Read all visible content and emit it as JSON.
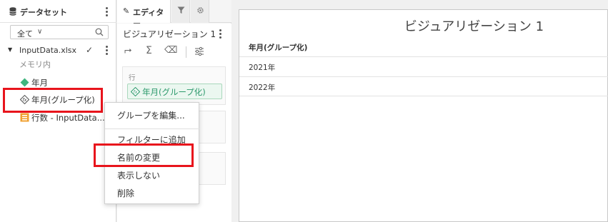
{
  "dataset_panel": {
    "title": "データセット",
    "filter_value": "全て",
    "file": {
      "name": "InputData.xlsx",
      "location": "メモリ内"
    },
    "fields": [
      {
        "label": "年月",
        "icon": "diamond-field-icon"
      },
      {
        "label": "年月(グループ化)",
        "icon": "calculated-field-icon"
      },
      {
        "label": "行数 - InputData...",
        "icon": "row-count-icon"
      }
    ]
  },
  "editor_panel": {
    "tab_label": "エディター",
    "visualization_name": "ビジュアリゼーション 1",
    "row_caption": "行",
    "row_field": "年月(グループ化)"
  },
  "context_menu": {
    "items": [
      "グループを編集...",
      "フィルターに追加",
      "名前の変更",
      "表示しない",
      "削除"
    ]
  },
  "visualization": {
    "title": "ビジュアリゼーション 1",
    "column_header": "年月(グループ化)",
    "rows": [
      "2021年",
      "2022年"
    ]
  },
  "colors": {
    "highlight_red": "#e8141c",
    "field_green": "#2d9a6c",
    "accent_orange": "#f0a030"
  }
}
